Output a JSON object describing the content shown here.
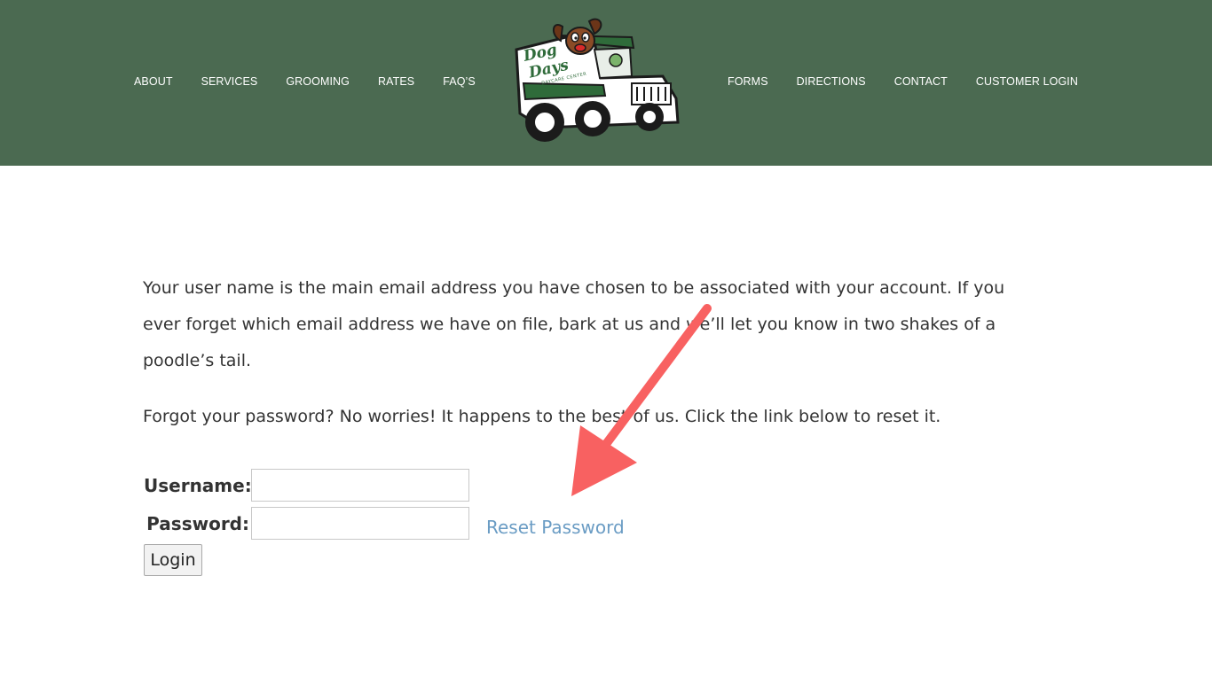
{
  "header": {
    "bg_color": "#4b6a51",
    "nav_left": [
      "ABOUT",
      "SERVICES",
      "GROOMING",
      "RATES",
      "FAQ’S"
    ],
    "nav_right": [
      "FORMS",
      "DIRECTIONS",
      "CONTACT",
      "CUSTOMER LOGIN"
    ],
    "logo": {
      "icon": "dog-days-truck-logo",
      "text_line1": "Dog",
      "text_line2": "Days",
      "subtext": "DAYCARE CENTER"
    }
  },
  "main": {
    "paragraph1": "Your user name is the main email address you have chosen to be associated with your account. If you ever forget which email address we have on file, bark at us and we’ll let you know in two shakes of a poodle’s tail.",
    "paragraph2": "Forgot your password? No worries! It happens to the best of us. Click the link below to reset it."
  },
  "login_form": {
    "username_label": "Username:",
    "username_value": "",
    "password_label": "Password:",
    "password_value": "",
    "reset_link": "Reset Password",
    "login_button": "Login",
    "link_color": "#6a9cc4"
  },
  "annotation": {
    "icon": "red-arrow-icon",
    "color": "#f86161"
  }
}
